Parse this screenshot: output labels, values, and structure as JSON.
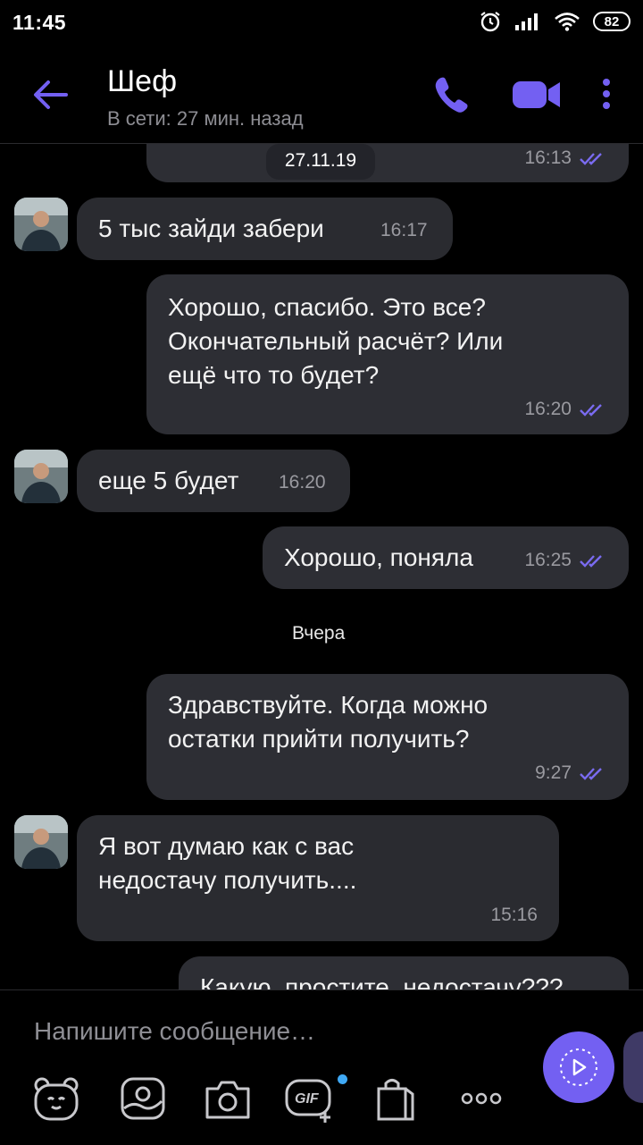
{
  "status_bar": {
    "time": "11:45",
    "battery": "82"
  },
  "header": {
    "contact_name": "Шеф",
    "presence": "В сети: 27 мин. назад"
  },
  "messages": [
    {
      "direction": "out",
      "text": "",
      "time": "16:13",
      "read": true
    },
    {
      "direction": "in",
      "text": "5 тыс зайди забери",
      "time": "16:17"
    },
    {
      "direction": "out",
      "lines": [
        "Хорошо, спасибо. Это все?",
        "Окончательный расчёт? Или",
        "ещё что то будет?"
      ],
      "time": "16:20",
      "read": true
    },
    {
      "direction": "in",
      "text": "еще 5 будет",
      "time": "16:20"
    },
    {
      "direction": "out",
      "text": "Хорошо, поняла",
      "time": "16:25",
      "read": true
    },
    {
      "direction": "out",
      "lines": [
        "Здравствуйте. Когда можно",
        "остатки прийти получить?"
      ],
      "time": "9:27",
      "read": true
    },
    {
      "direction": "in",
      "lines": [
        "Я вот думаю как с вас",
        "недостачу получить...."
      ],
      "time": "15:16"
    },
    {
      "direction": "out",
      "text": "Какую, простите, недостачу???",
      "time": ""
    }
  ],
  "dividers": {
    "date_pill": "27.11.19",
    "yesterday": "Вчера"
  },
  "composer": {
    "placeholder": "Напишите сообщение…"
  },
  "icons": {
    "back": "arrow-left-icon",
    "call": "phone-icon",
    "video": "video-camera-icon",
    "more": "kebab-menu-icon",
    "sticker": "bear-sticker-icon",
    "gallery": "gallery-icon",
    "camera": "camera-icon",
    "gif": "gif-icon",
    "shop": "shopping-bag-icon",
    "more_tools": "more-horizontal-icon",
    "send": "voice-record-icon"
  },
  "colors": {
    "accent": "#7360f2",
    "bubble": "#2d2e34",
    "background": "#000000",
    "new_badge": "#3fa9f5"
  }
}
